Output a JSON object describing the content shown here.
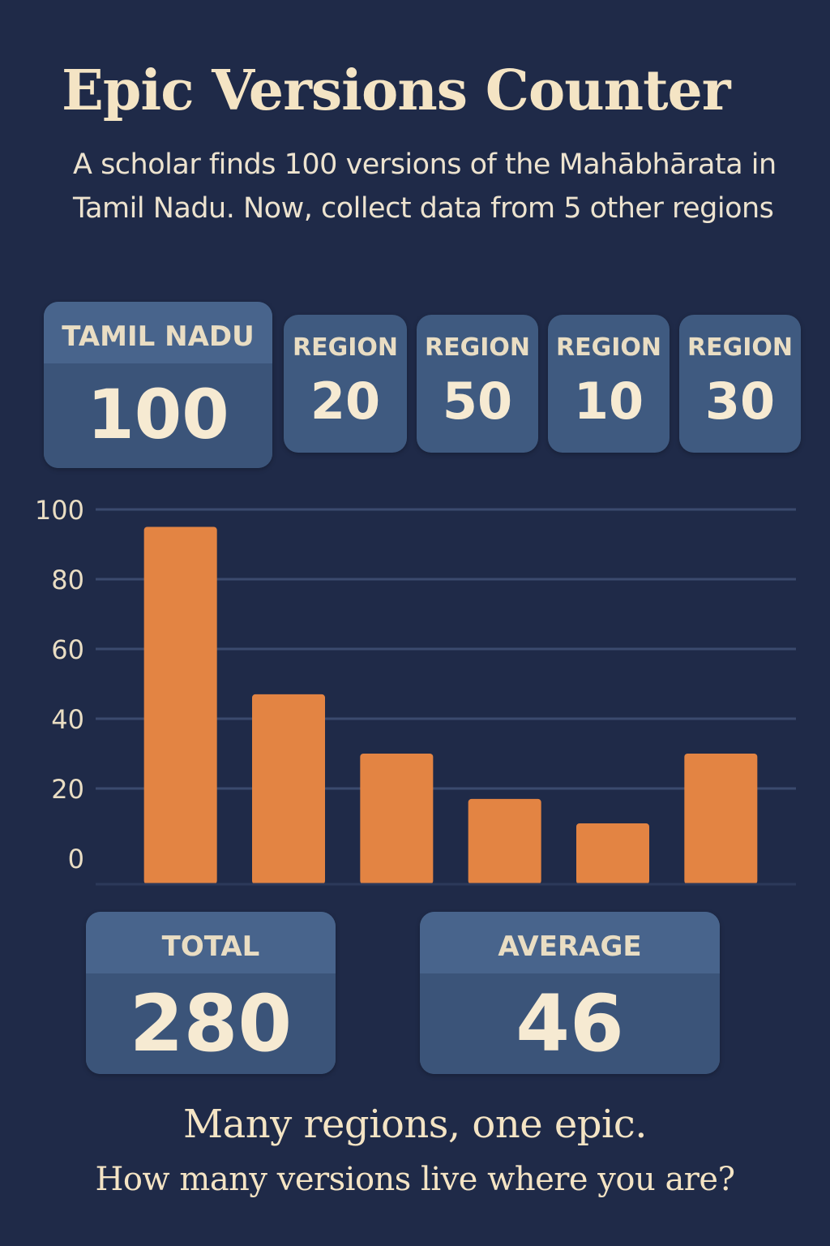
{
  "title": "Epic Versions Counter",
  "subtitle": "A scholar finds 100 versions of the Mahābhārata in Tamil Nadu. Now, collect data from 5 other regions",
  "region_cards": [
    {
      "label": "TAMIL NADU",
      "value": "100"
    },
    {
      "label": "REGION",
      "value": "20"
    },
    {
      "label": "REGION",
      "value": "50"
    },
    {
      "label": "REGION",
      "value": "10"
    },
    {
      "label": "REGION",
      "value": "30"
    }
  ],
  "summary": {
    "total_label": "TOTAL",
    "total_value": "280",
    "average_label": "AVERAGE",
    "average_value": "46"
  },
  "closing": {
    "line1": "Many regions, one epic.",
    "line2": "How many versions live where you are?"
  },
  "colors": {
    "background": "#1f2a48",
    "card": "#3f5a80",
    "bar": "#e38443",
    "text": "#f4e4c4",
    "gridline": "#3b4a6e"
  },
  "chart_data": {
    "type": "bar",
    "categories": [
      "",
      "",
      "",
      "",
      "",
      ""
    ],
    "values": [
      95,
      47,
      30,
      17,
      10,
      30
    ],
    "title": "",
    "xlabel": "",
    "ylabel": "",
    "ylim": [
      0,
      100
    ],
    "yticks": [
      0,
      20,
      40,
      60,
      80,
      100
    ],
    "grid": true,
    "legend": "none"
  }
}
